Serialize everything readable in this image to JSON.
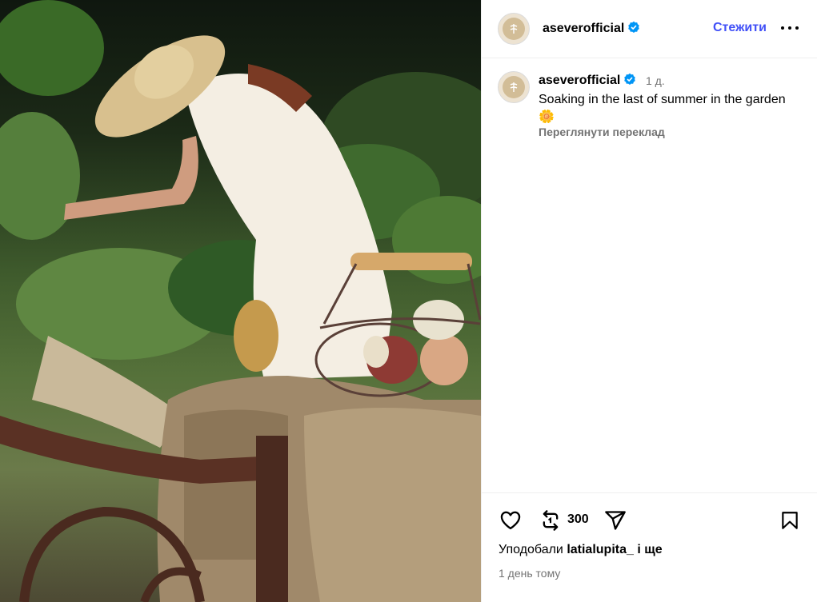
{
  "post": {
    "image_alt": "Woman in a white dress and straw hat tending a garden, with a wire basket of eggs on a stone wall",
    "username": "aseverofficial",
    "verified": true,
    "follow_label": "Стежити",
    "more_icon": "more-horizontal-icon",
    "caption": {
      "username": "aseverofficial",
      "time_ago": "1 д.",
      "text": "Soaking in the last of summer in the garden 🌼",
      "translate_label": "Переглянути переклад"
    },
    "actions": {
      "like_icon": "heart-icon",
      "repost_icon": "repost-icon",
      "repost_count": "300",
      "share_icon": "share-icon",
      "save_icon": "bookmark-icon"
    },
    "likes": {
      "prefix": "Уподобали",
      "user": "latialupita_",
      "suffix": "і ще"
    },
    "date_label": "1 день тому"
  },
  "colors": {
    "accent": "#4150f7",
    "verified": "#0095f6",
    "secondary_text": "#737373"
  }
}
